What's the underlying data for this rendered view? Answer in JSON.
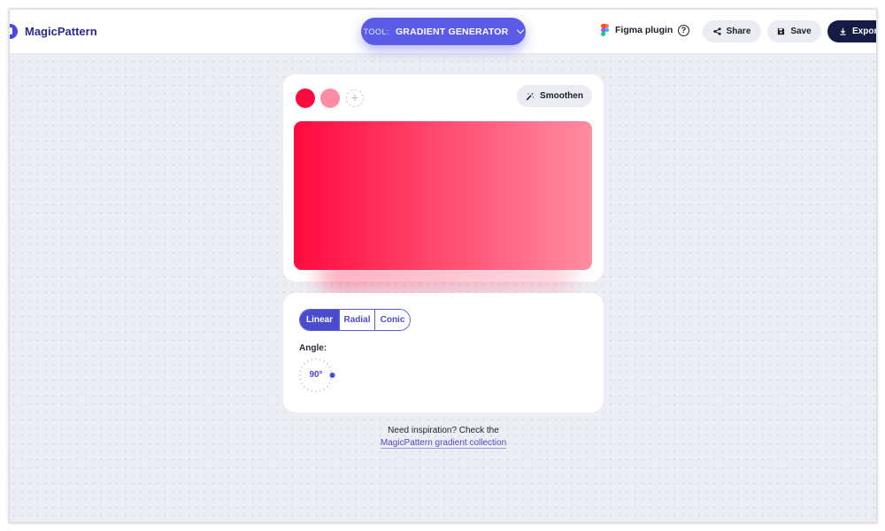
{
  "header": {
    "brand": "MagicPattern",
    "tool_prefix": "TOOL:",
    "tool_name": "GRADIENT GENERATOR",
    "figma_label": "Figma plugin",
    "help_glyph": "?",
    "share_label": "Share",
    "save_label": "Save",
    "export_label": "Export"
  },
  "editor": {
    "smoothen_label": "Smoothen",
    "add_stop_glyph": "+",
    "color_stops": [
      "#ff0a3e",
      "#ff8da2"
    ],
    "gradient": {
      "type": "linear",
      "angle": 90
    }
  },
  "controls": {
    "types": [
      {
        "label": "Linear",
        "active": true
      },
      {
        "label": "Radial",
        "active": false
      },
      {
        "label": "Conic",
        "active": false
      }
    ],
    "angle_label": "Angle:",
    "angle_value": "90°"
  },
  "footer": {
    "prompt": "Need inspiration? Check the",
    "link": "MagicPattern gradient collection"
  },
  "colors": {
    "accent": "#5b5ce8",
    "accent_dark": "#4b4ccd",
    "export_bg": "#141c45"
  }
}
